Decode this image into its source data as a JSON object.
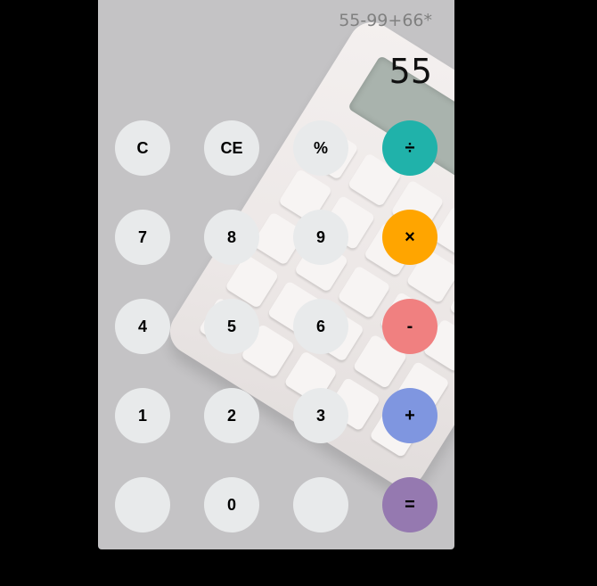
{
  "display": {
    "expression": "55-99+66*",
    "result": "55"
  },
  "colors": {
    "page_background": "#000000",
    "panel_background": "#c4c3c5",
    "key_default": "#e8eaeb",
    "divide": "#20b2aa",
    "multiply": "#ffa500",
    "subtract": "#f08080",
    "add": "#7f96e0",
    "equals": "#9579b0"
  },
  "keys": {
    "clear": "C",
    "clear_entry": "CE",
    "percent": "%",
    "divide": "÷",
    "seven": "7",
    "eight": "8",
    "nine": "9",
    "multiply": "×",
    "four": "4",
    "five": "5",
    "six": "6",
    "subtract": "-",
    "one": "1",
    "two": "2",
    "three": "3",
    "add": "+",
    "blank_left": "",
    "zero": "0",
    "blank_right": "",
    "equals": "="
  }
}
